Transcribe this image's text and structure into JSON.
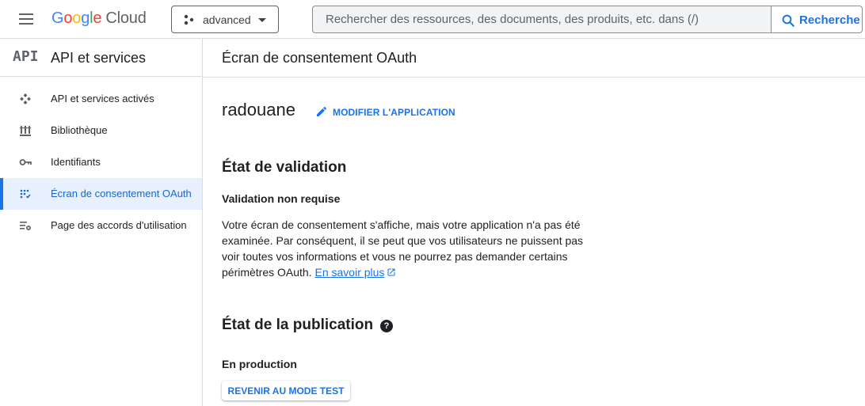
{
  "header": {
    "menu_icon": "hamburger-menu-icon",
    "logo_text": "Google Cloud",
    "project": {
      "name": "advanced",
      "icon": "project-dots-icon"
    },
    "search": {
      "placeholder": "Rechercher des ressources, des documents, des produits, etc. dans (/)",
      "button_label": "Recherche",
      "icon": "search-icon"
    }
  },
  "sidebar": {
    "logo_text": "API",
    "title": "API et services",
    "items": [
      {
        "label": "API et services activés",
        "icon": "api-services-icon",
        "active": false
      },
      {
        "label": "Bibliothèque",
        "icon": "library-icon",
        "active": false
      },
      {
        "label": "Identifiants",
        "icon": "key-icon",
        "active": false
      },
      {
        "label": "Écran de consentement OAuth",
        "icon": "oauth-consent-icon",
        "active": true
      },
      {
        "label": "Page des accords d'utilisation",
        "icon": "agreements-icon",
        "active": false
      }
    ]
  },
  "main": {
    "title": "Écran de consentement OAuth",
    "app_name": "radouane",
    "edit_button": "MODIFIER L'APPLICATION",
    "validation": {
      "heading": "État de validation",
      "status": "Validation non requise",
      "description_lines": [
        "Votre écran de consentement s'affiche, mais votre application n'a pas été",
        "examinée. Par conséquent, il se peut que vos utilisateurs ne puissent pas",
        "voir toutes vos informations et vous ne pourrez pas demander certains",
        "périmètres OAuth."
      ],
      "learn_more": "En savoir plus"
    },
    "publication": {
      "heading": "État de la publication",
      "help_icon": "?",
      "status": "En production",
      "button": "REVENIR AU MODE TEST"
    }
  },
  "colors": {
    "accent": "#1a73e8",
    "active_bg": "#e8f0fe",
    "border": "#dadce0"
  }
}
